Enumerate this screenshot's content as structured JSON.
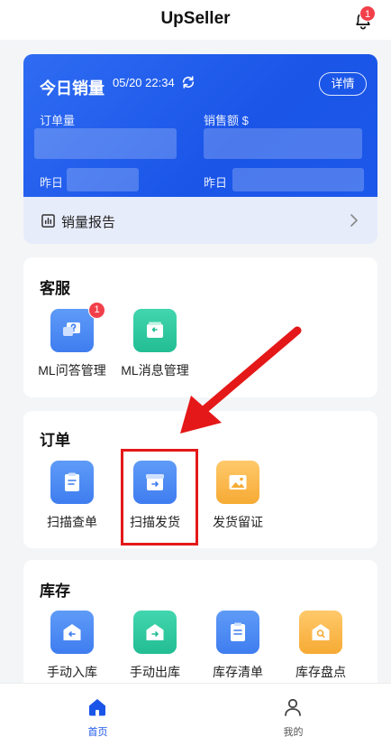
{
  "header": {
    "title": "UpSeller",
    "notification_count": "1"
  },
  "sales": {
    "title": "今日销量",
    "time": "05/20 22:34",
    "detail_label": "详情",
    "orders_label": "订单量",
    "amount_label": "销售额 $",
    "yesterday_left": "昨日",
    "yesterday_right": "昨日",
    "report_label": "销量报告"
  },
  "sections": {
    "service": {
      "title": "客服",
      "items": [
        {
          "label": "ML问答管理",
          "icon": "question-chat-icon",
          "badge": "1"
        },
        {
          "label": "ML消息管理",
          "icon": "message-box-icon"
        }
      ]
    },
    "orders": {
      "title": "订单",
      "items": [
        {
          "label": "扫描查单",
          "icon": "clipboard-scan-icon"
        },
        {
          "label": "扫描发货",
          "icon": "box-ship-icon"
        },
        {
          "label": "发货留证",
          "icon": "photo-icon"
        }
      ]
    },
    "inventory": {
      "title": "库存",
      "items": [
        {
          "label": "手动入库",
          "icon": "warehouse-in-icon"
        },
        {
          "label": "手动出库",
          "icon": "warehouse-out-icon"
        },
        {
          "label": "库存清单",
          "icon": "list-clipboard-icon"
        },
        {
          "label": "库存盘点",
          "icon": "warehouse-search-icon"
        }
      ]
    }
  },
  "nav": {
    "home": "首页",
    "mine": "我的"
  },
  "colors": {
    "accent": "#1a55e8",
    "highlight": "#e41818",
    "badge": "#f2404b"
  }
}
